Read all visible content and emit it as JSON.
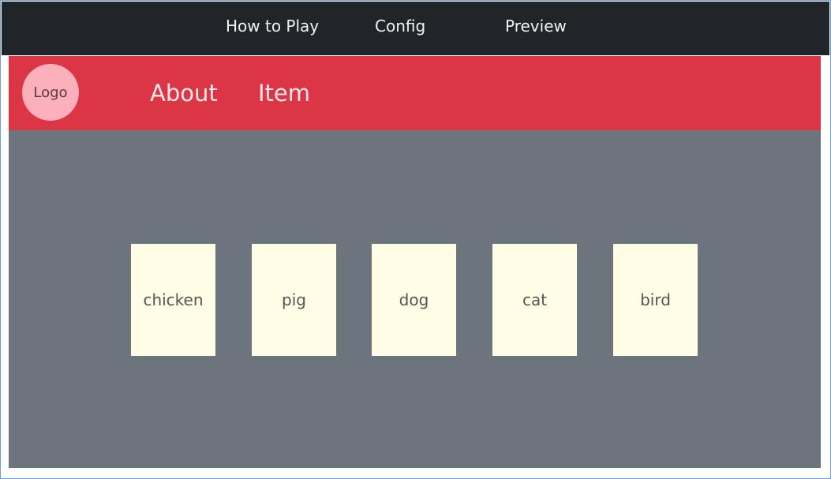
{
  "topbar": {
    "items": [
      "How to Play",
      "Config",
      "Preview"
    ]
  },
  "header": {
    "logo": "Logo",
    "nav": [
      "About",
      "Item"
    ]
  },
  "cards": [
    "chicken",
    "pig",
    "dog",
    "cat",
    "bird"
  ],
  "colors": {
    "topbar": "#212529",
    "header": "#dc3545",
    "stage": "#6c757d",
    "card": "#fffde6",
    "logo": "#fbb0bb"
  }
}
